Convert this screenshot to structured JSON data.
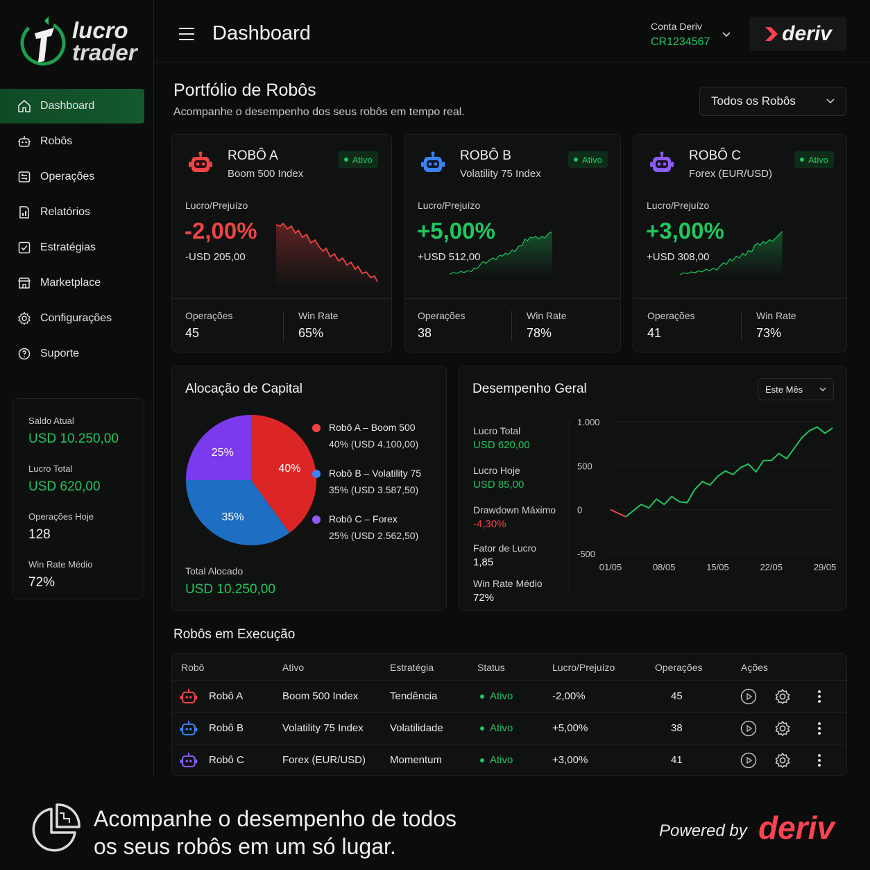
{
  "brand": {
    "line1": "lucro",
    "line2": "trader"
  },
  "colors": {
    "accent": "#22c55e",
    "negative": "#ef4444",
    "robot_a": "#ef4444",
    "robot_b": "#3b82f6",
    "robot_c": "#8b5cf6",
    "deriv": "#ff444f"
  },
  "sidebar": {
    "items": [
      {
        "label": "Dashboard",
        "icon": "home-icon"
      },
      {
        "label": "Robôs",
        "icon": "robot-icon"
      },
      {
        "label": "Operações",
        "icon": "operations-icon"
      },
      {
        "label": "Relatórios",
        "icon": "reports-icon"
      },
      {
        "label": "Estratégias",
        "icon": "strategy-icon"
      },
      {
        "label": "Marketplace",
        "icon": "store-icon"
      },
      {
        "label": "Configurações",
        "icon": "gear-icon"
      },
      {
        "label": "Suporte",
        "icon": "support-icon"
      }
    ],
    "balance": {
      "saldo_label": "Saldo Atual",
      "saldo_value": "USD 10.250,00",
      "lucro_label": "Lucro Total",
      "lucro_value": "USD 620,00",
      "ops_label": "Operações Hoje",
      "ops_value": "128",
      "winrate_label": "Win Rate Médio",
      "winrate_value": "72%"
    }
  },
  "header": {
    "title": "Dashboard",
    "account_label": "Conta Deriv",
    "account_id": "CR1234567",
    "deriv_logo": "deriv"
  },
  "portfolio": {
    "title": "Portfólio de Robôs",
    "subtitle": "Acompanhe o desempenho dos seus robôs em tempo real.",
    "filter": "Todos os Robôs"
  },
  "robots": [
    {
      "name": "ROBÔ A",
      "asset": "Boom 500 Index",
      "status": "Ativo",
      "pl_label": "Lucro/Prejuízo",
      "pct": "-2,00%",
      "usd": "-USD 205,00",
      "ops_label": "Operações",
      "ops": "45",
      "wr_label": "Win Rate",
      "wr": "65%",
      "trend": "down"
    },
    {
      "name": "ROBÔ B",
      "asset": "Volatility 75 Index",
      "status": "Ativo",
      "pl_label": "Lucro/Prejuízo",
      "pct": "+5,00%",
      "usd": "+USD 512,00",
      "ops_label": "Operações",
      "ops": "38",
      "wr_label": "Win Rate",
      "wr": "78%",
      "trend": "up"
    },
    {
      "name": "ROBÔ C",
      "asset": "Forex (EUR/USD)",
      "status": "Ativo",
      "pl_label": "Lucro/Prejuízo",
      "pct": "+3,00%",
      "usd": "+USD 308,00",
      "ops_label": "Operações",
      "ops": "41",
      "wr_label": "Win Rate",
      "wr": "73%",
      "trend": "up"
    }
  ],
  "allocation": {
    "title": "Alocação de Capital",
    "slices": [
      {
        "pct_label": "40%",
        "value": 40,
        "color": "#dc2626",
        "name": "Robô A – Boom 500",
        "detail_pct": "40%",
        "detail_usd": "(USD 4.100,00)"
      },
      {
        "pct_label": "35%",
        "value": 35,
        "color": "#1d6fc4",
        "name": "Robô B – Volatility 75",
        "detail_pct": "35%",
        "detail_usd": "(USD 3.587,50)"
      },
      {
        "pct_label": "25%",
        "value": 25,
        "color": "#7c3aed",
        "name": "Robô C – Forex",
        "detail_pct": "25%",
        "detail_usd": "(USD 2.562,50)"
      }
    ],
    "total_label": "Total Alocado",
    "total_value": "USD 10.250,00"
  },
  "performance": {
    "title": "Desempenho Geral",
    "period": "Este Mês",
    "stats": [
      {
        "label": "Lucro Total",
        "value": "USD 620,00",
        "tone": "green"
      },
      {
        "label": "Lucro Hoje",
        "value": "USD 85,00",
        "tone": "green"
      },
      {
        "label": "Drawdown Máximo",
        "value": "-4,30%",
        "tone": "red"
      },
      {
        "label": "Fator de Lucro",
        "value": "1,85",
        "tone": "white"
      },
      {
        "label": "Win Rate Médio",
        "value": "72%",
        "tone": "white"
      }
    ]
  },
  "chart_data": {
    "type": "line",
    "title": "Desempenho Geral",
    "x_ticks": [
      "01/05",
      "08/05",
      "15/05",
      "22/05",
      "29/05"
    ],
    "y_ticks": [
      "1.000",
      "500",
      "0",
      "-500"
    ],
    "ylim": [
      -500,
      1000
    ],
    "xlim": [
      1,
      30
    ],
    "x": [
      1,
      2,
      3,
      4,
      5,
      6,
      7,
      8,
      9,
      10,
      11,
      12,
      13,
      14,
      15,
      16,
      17,
      18,
      19,
      20,
      21,
      22,
      23,
      24,
      25,
      26,
      27,
      28,
      29,
      30
    ],
    "y": [
      0,
      -40,
      -80,
      -10,
      60,
      20,
      120,
      60,
      150,
      90,
      80,
      230,
      320,
      280,
      380,
      440,
      400,
      480,
      520,
      430,
      560,
      560,
      640,
      580,
      700,
      820,
      900,
      940,
      870,
      930
    ],
    "series_colors": [
      "#ef4444",
      "#22c55e"
    ],
    "grid": true
  },
  "running": {
    "title": "Robôs em Execução",
    "headers": [
      "Robô",
      "Ativo",
      "Estratégia",
      "Status",
      "Lucro/Prejuízo",
      "Operações",
      "Ações"
    ],
    "rows": [
      {
        "robot": "Robô A",
        "asset": "Boom 500 Index",
        "strategy": "Tendência",
        "status": "Ativo",
        "pl": "-2,00%",
        "ops": "45",
        "color": "#ef4444"
      },
      {
        "robot": "Robô B",
        "asset": "Volatility 75 Index",
        "strategy": "Volatilidade",
        "status": "Ativo",
        "pl": "+5,00%",
        "ops": "38",
        "color": "#3b82f6"
      },
      {
        "robot": "Robô C",
        "asset": "Forex (EUR/USD)",
        "strategy": "Momentum",
        "status": "Ativo",
        "pl": "+3,00%",
        "ops": "41",
        "color": "#8b5cf6"
      }
    ]
  },
  "footer": {
    "line1": "Acompanhe o desempenho de todos",
    "line2": "os seus robôs em um só lugar.",
    "powered": "Powered by",
    "deriv": "deriv"
  }
}
